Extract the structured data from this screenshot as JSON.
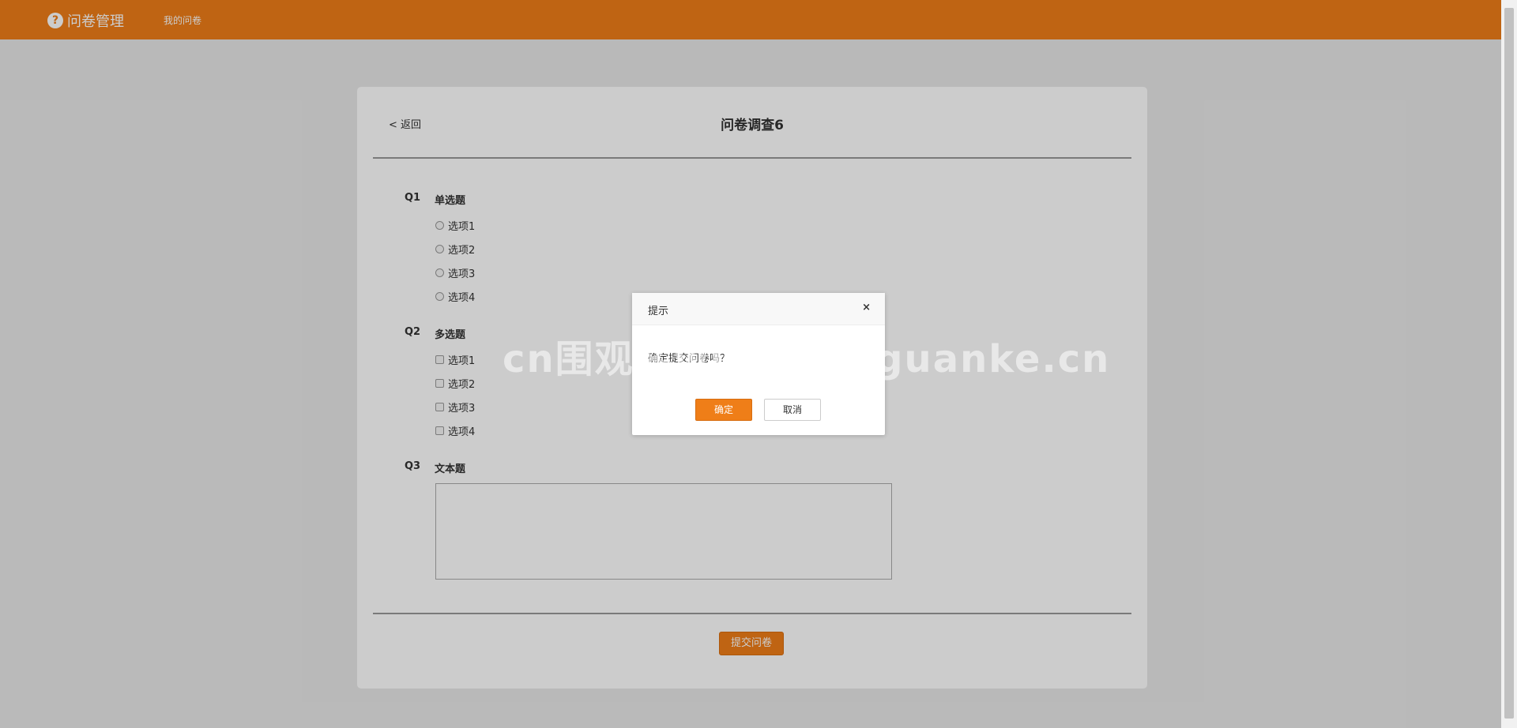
{
  "app": {
    "brand_icon": "?",
    "title": "问卷管理",
    "nav_my_surveys": "我的问卷"
  },
  "survey": {
    "back_label": "< 返回",
    "title": "问卷调查6",
    "questions": [
      {
        "num": "Q1",
        "title": "单选题",
        "type": "radio",
        "options": [
          "选项1",
          "选项2",
          "选项3",
          "选项4"
        ]
      },
      {
        "num": "Q2",
        "title": "多选题",
        "type": "checkbox",
        "options": [
          "选项1",
          "选项2",
          "选项3",
          "选项4"
        ]
      },
      {
        "num": "Q3",
        "title": "文本题",
        "type": "text",
        "value": ""
      }
    ],
    "submit_label": "提交问卷"
  },
  "dialog": {
    "title": "提示",
    "close": "×",
    "message": "确定提交问卷吗？",
    "ok_label": "确定",
    "cancel_label": "取消"
  },
  "watermark": "cn围观客www.weiguanke.cn",
  "colors": {
    "accent": "#ef7e18",
    "overlay": "rgba(0,0,0,0.2)"
  },
  "icons": {
    "brand": "question-circle-icon",
    "close": "close-icon"
  }
}
